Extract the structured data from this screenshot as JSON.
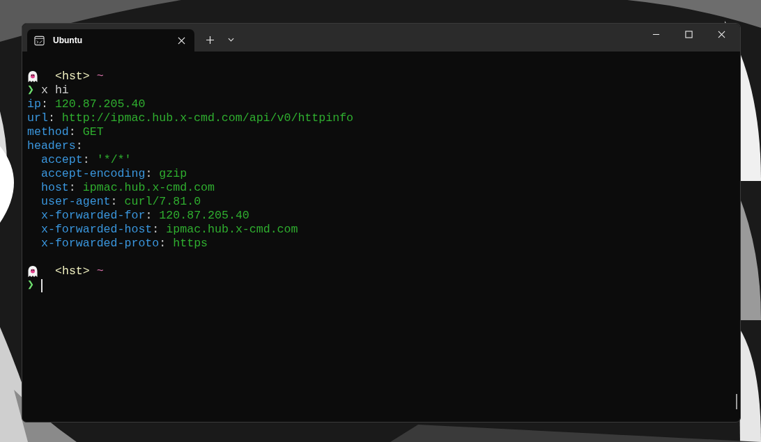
{
  "window": {
    "tab": {
      "title": "Ubuntu",
      "selected": true
    }
  },
  "terminal": {
    "lines": [
      {
        "kind": "prompt",
        "host": "<hst>",
        "dir": "~"
      },
      {
        "kind": "command",
        "symbol": "❯",
        "text": "x hi"
      },
      {
        "kind": "field",
        "key": "ip",
        "separator": ":",
        "value": "120.87.205.40"
      },
      {
        "kind": "field",
        "key": "url",
        "separator": ":",
        "value": "http://ipmac.hub.x-cmd.com/api/v0/httpinfo"
      },
      {
        "kind": "field",
        "key": "method",
        "separator": ":",
        "value": "GET"
      },
      {
        "kind": "field",
        "key": "headers",
        "separator": ":",
        "children": [
          {
            "key": "accept",
            "separator": ":",
            "value": "'*/*'"
          },
          {
            "key": "accept-encoding",
            "separator": ":",
            "value": "gzip"
          },
          {
            "key": "host",
            "separator": ":",
            "value": "ipmac.hub.x-cmd.com"
          },
          {
            "key": "user-agent",
            "separator": ":",
            "value": "curl/7.81.0"
          },
          {
            "key": "x-forwarded-for",
            "separator": ":",
            "value": "120.87.205.40"
          },
          {
            "key": "x-forwarded-host",
            "separator": ":",
            "value": "ipmac.hub.x-cmd.com"
          },
          {
            "key": "x-forwarded-proto",
            "separator": ":",
            "value": "https"
          }
        ]
      },
      {
        "kind": "blank"
      },
      {
        "kind": "prompt",
        "host": "<hst>",
        "dir": "~"
      },
      {
        "kind": "input",
        "symbol": "❯"
      }
    ]
  }
}
